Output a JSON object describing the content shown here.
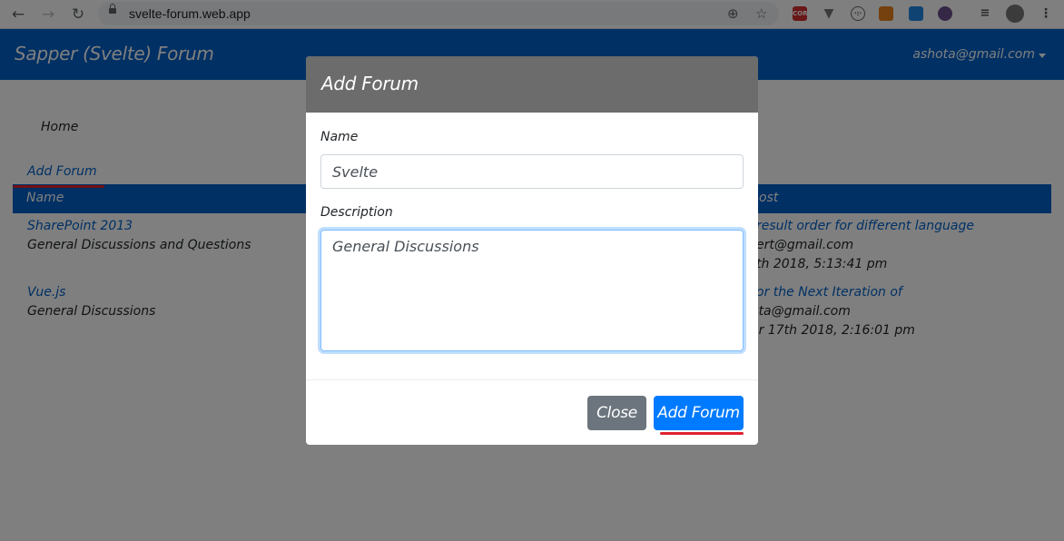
{
  "browser": {
    "url": "svelte-forum.web.app",
    "back_icon": "arrow-left",
    "forward_icon": "arrow-right",
    "reload_icon": "reload",
    "extensions": [
      "CORS",
      "V",
      "G",
      "fox",
      "layers",
      "globe",
      "playlist",
      "avatar",
      "menu"
    ]
  },
  "navbar": {
    "brand": "Sapper (Svelte)  Forum",
    "user": "ashota@gmail.com"
  },
  "page": {
    "breadcrumb": "Home",
    "add_forum_link": "Add Forum",
    "table": {
      "headers": [
        "Name",
        "ost"
      ],
      "rows": [
        {
          "name": "SharePoint 2013",
          "description": "General Discussions and Questions",
          "post_title": " result order for different language",
          "post_user": "ert@gmail.com",
          "post_date": "th 2018, 5:13:41 pm"
        },
        {
          "name": "Vue.js",
          "description": "General Discussions",
          "post_title": "or the Next Iteration of",
          "post_user": "ota@gmail.com",
          "post_date": "er 17th 2018, 2:16:01 pm"
        }
      ]
    }
  },
  "modal": {
    "title": "Add Forum",
    "name_label": "Name",
    "name_value": "Svelte",
    "description_label": "Description",
    "description_value": "General Discussions",
    "close_label": "Close",
    "submit_label": "Add Forum"
  },
  "colors": {
    "primary": "#0061c9",
    "button_primary": "#007bff",
    "button_secondary": "#6c757d",
    "highlight": "#e0202f"
  }
}
